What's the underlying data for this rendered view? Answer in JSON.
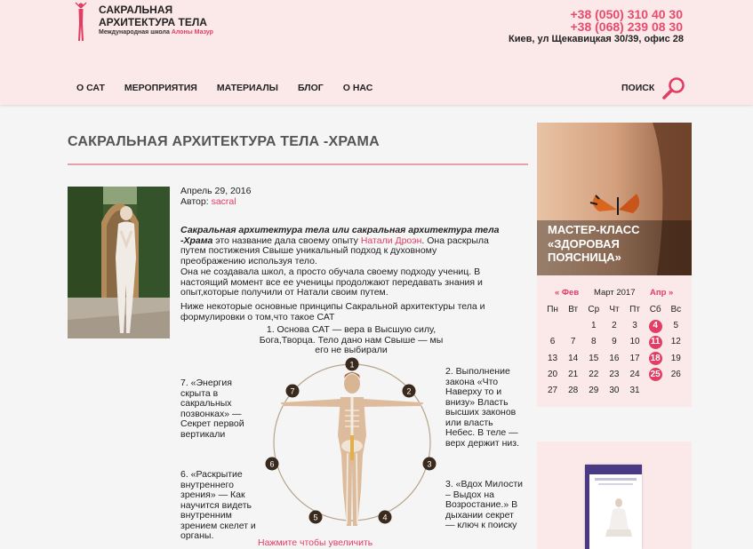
{
  "header": {
    "logo_title": "САКРАЛЬНАЯ АРХИТЕКТУРА ТЕЛА",
    "logo_sub_prefix": "Международная школа",
    "logo_sub_name": "Алоны Мазур",
    "phone1": "+38 (050) 310 40 30",
    "phone2": "+38 (068) 239 08 30",
    "address": "Киев, ул Щекавицкая 30/39, офис 28",
    "nav": [
      "О САТ",
      "МЕРОПРИЯТИЯ",
      "МАТЕРИАЛЫ",
      "БЛОГ",
      "О НАС"
    ],
    "search_label": "ПОИСК",
    "accent_color": "#e23d64"
  },
  "post": {
    "title": "САКРАЛЬНАЯ АРХИТЕКТУРА ТЕЛА -ХРАМА",
    "date": "Апрель 29, 2016",
    "author_label": "Автор:",
    "author": "sacral",
    "p1_bold": "Сакральная архитектура тела или сакральная архитектура тела -Храма",
    "p1_mid": " это название дала своему опыту ",
    "p1_link": "Натали Дроэн",
    "p1_end": ". Она раскрыла путем постижения Свыше уникальный подход к духовному преображению используя тело.",
    "p2": "Она не создавала школ, а просто обучала своему подходу учениц. В настоящий момент все ее ученицы продолжают передавать  знания и опыт,которые получили от Натали своим путем.",
    "p3": "Ниже некоторые основные принципы Сакральной архитектуры тела и формулировки о том,что такое САТ",
    "principle1": "1. Основа САТ — вера в Высшую силу, Бога,Творца. Тело дано нам Свыше — мы его не выбирали",
    "principle2": "2. Выполнение закона «Что Наверху то и внизу» Власть высших законов или власть Небес. В теле — верх держит низ.",
    "principle3": "3. «Вдох Милости – Выдох на Возростание.» В дыхании секрет — ключ к поиску",
    "principle6": "6. «Раскрытие внутреннего зрения» — Как научится видеть внутренним зрением скелет и органы.",
    "principle7": "7. «Энергия скрыта в сакральных позвонках» — Секрет первой вертикали",
    "diagram_numbers": [
      "1",
      "2",
      "3",
      "4",
      "5",
      "6",
      "7"
    ],
    "enlarge": "Нажмите чтобы увеличить"
  },
  "sidebar": {
    "promo": "МАСТЕР-КЛАСС «ЗДОРОВАЯ ПОЯСНИЦА»",
    "calendar": {
      "prev": "« Фев",
      "month": "Март 2017",
      "next": "Апр »",
      "weekdays": [
        "Пн",
        "Вт",
        "Ср",
        "Чт",
        "Пт",
        "Сб",
        "Вс"
      ],
      "weeks": [
        [
          "",
          "",
          "1",
          "2",
          "3",
          "4",
          "5"
        ],
        [
          "6",
          "7",
          "8",
          "9",
          "10",
          "11",
          "12"
        ],
        [
          "13",
          "14",
          "15",
          "16",
          "17",
          "18",
          "19"
        ],
        [
          "20",
          "21",
          "22",
          "23",
          "24",
          "25",
          "26"
        ],
        [
          "27",
          "28",
          "29",
          "30",
          "31",
          "",
          ""
        ]
      ],
      "highlighted": [
        "4",
        "11",
        "18",
        "25"
      ]
    }
  }
}
